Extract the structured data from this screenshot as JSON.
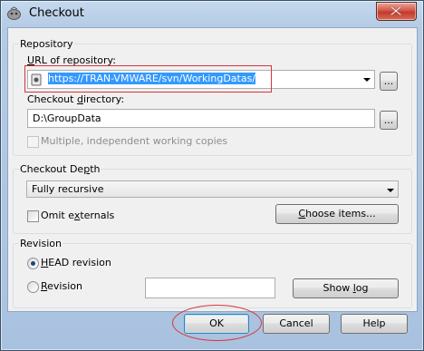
{
  "window": {
    "title": "Checkout",
    "close_icon": "close-icon"
  },
  "repository": {
    "group_label": "Repository",
    "url_label_pre": "",
    "url_label_u": "U",
    "url_label_post": "RL of repository:",
    "url_value": "https://TRAN-VMWARE/svn/WorkingDatas/",
    "browse_url_label": "...",
    "dir_label_pre": "Checkout ",
    "dir_label_u": "d",
    "dir_label_post": "irectory:",
    "dir_value": "D:\\GroupData",
    "browse_dir_label": "...",
    "multiple_label": "Multiple, independent working copies"
  },
  "depth": {
    "group_label_pre": "Checkout De",
    "group_label_u": "p",
    "group_label_post": "th",
    "selected": "Fully recursive",
    "omit_pre": "Omit e",
    "omit_u": "x",
    "omit_post": "ternals",
    "choose_pre": "",
    "choose_u": "C",
    "choose_post": "hoose items..."
  },
  "revision": {
    "group_label": "Revision",
    "head_u": "H",
    "head_post": "EAD revision",
    "rev_u": "R",
    "rev_post": "evision",
    "rev_value": "",
    "showlog_pre": "Show ",
    "showlog_u": "l",
    "showlog_post": "og"
  },
  "buttons": {
    "ok": "OK",
    "cancel": "Cancel",
    "help": "Help"
  },
  "colors": {
    "annotation": "#d9343c",
    "selection": "#3399ff"
  }
}
